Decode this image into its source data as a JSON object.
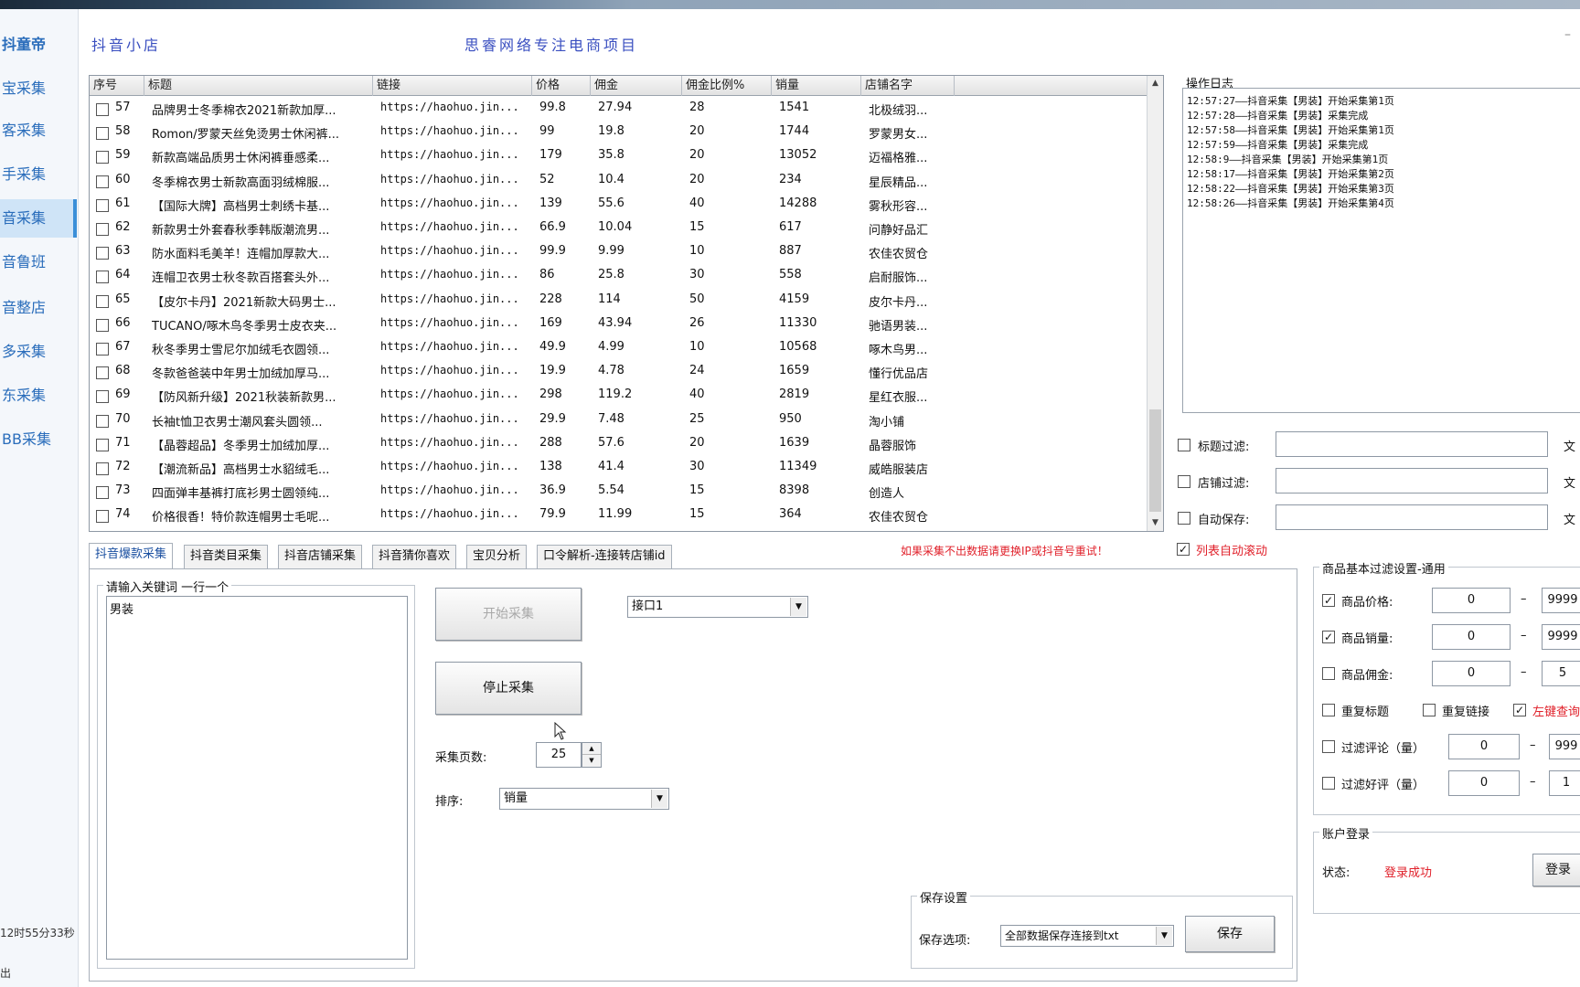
{
  "app": {
    "brand": "抖童帝",
    "shop_name": "抖音小店",
    "slogan": "思睿网络专注电商项目"
  },
  "sidebar": {
    "items": [
      {
        "label": "宝采集"
      },
      {
        "label": "客采集"
      },
      {
        "label": "手采集"
      },
      {
        "label": "音采集"
      },
      {
        "label": "音鲁班"
      },
      {
        "label": "音整店"
      },
      {
        "label": "多采集"
      },
      {
        "label": "东采集"
      },
      {
        "label": "BB采集"
      }
    ],
    "footer_time": "12时55分33秒",
    "footer_exit": "出"
  },
  "grid": {
    "columns": [
      "序号",
      "标题",
      "链接",
      "价格",
      "佣金",
      "佣金比例%",
      "销量",
      "店铺名字"
    ],
    "rows": [
      {
        "id": "57",
        "title": "品牌男士冬季棉衣2021新款加厚...",
        "link": "https://haohuo.jin...",
        "price": "99.8",
        "commission": "27.94",
        "rate": "28",
        "sales": "1541",
        "shop": "北极绒羽..."
      },
      {
        "id": "58",
        "title": "Romon/罗蒙天丝免烫男士休闲裤...",
        "link": "https://haohuo.jin...",
        "price": "99",
        "commission": "19.8",
        "rate": "20",
        "sales": "1744",
        "shop": "罗蒙男女..."
      },
      {
        "id": "59",
        "title": "新款高端品质男士休闲裤垂感柔...",
        "link": "https://haohuo.jin...",
        "price": "179",
        "commission": "35.8",
        "rate": "20",
        "sales": "13052",
        "shop": "迈福格雅..."
      },
      {
        "id": "60",
        "title": "冬季棉衣男士新款高面羽绒棉服...",
        "link": "https://haohuo.jin...",
        "price": "52",
        "commission": "10.4",
        "rate": "20",
        "sales": "234",
        "shop": "星辰精品..."
      },
      {
        "id": "61",
        "title": "【国际大牌】高档男士刺绣卡基...",
        "link": "https://haohuo.jin...",
        "price": "139",
        "commission": "55.6",
        "rate": "40",
        "sales": "14288",
        "shop": "雾秋形容..."
      },
      {
        "id": "62",
        "title": "新款男士外套春秋季韩版潮流男...",
        "link": "https://haohuo.jin...",
        "price": "66.9",
        "commission": "10.04",
        "rate": "15",
        "sales": "617",
        "shop": "问静好品汇"
      },
      {
        "id": "63",
        "title": "防水面料毛美羊！连帽加厚款大...",
        "link": "https://haohuo.jin...",
        "price": "99.9",
        "commission": "9.99",
        "rate": "10",
        "sales": "887",
        "shop": "农佳农贸仓"
      },
      {
        "id": "64",
        "title": "连帽卫衣男士秋冬款百搭套头外...",
        "link": "https://haohuo.jin...",
        "price": "86",
        "commission": "25.8",
        "rate": "30",
        "sales": "558",
        "shop": "启耐服饰..."
      },
      {
        "id": "65",
        "title": "【皮尔卡丹】2021新款大码男士...",
        "link": "https://haohuo.jin...",
        "price": "228",
        "commission": "114",
        "rate": "50",
        "sales": "4159",
        "shop": "皮尔卡丹..."
      },
      {
        "id": "66",
        "title": "TUCANO/啄木鸟冬季男士皮衣夹...",
        "link": "https://haohuo.jin...",
        "price": "169",
        "commission": "43.94",
        "rate": "26",
        "sales": "11330",
        "shop": "驰语男装..."
      },
      {
        "id": "67",
        "title": "秋冬季男士雪尼尔加绒毛衣圆领...",
        "link": "https://haohuo.jin...",
        "price": "49.9",
        "commission": "4.99",
        "rate": "10",
        "sales": "10568",
        "shop": "啄木鸟男..."
      },
      {
        "id": "68",
        "title": "冬款爸爸装中年男士加绒加厚马...",
        "link": "https://haohuo.jin...",
        "price": "19.9",
        "commission": "4.78",
        "rate": "24",
        "sales": "1659",
        "shop": "懂行优品店"
      },
      {
        "id": "69",
        "title": "【防风新升级】2021秋装新款男...",
        "link": "https://haohuo.jin...",
        "price": "298",
        "commission": "119.2",
        "rate": "40",
        "sales": "2819",
        "shop": "星红衣服..."
      },
      {
        "id": "70",
        "title": "长袖t恤卫衣男士潮风套头圆领...",
        "link": "https://haohuo.jin...",
        "price": "29.9",
        "commission": "7.48",
        "rate": "25",
        "sales": "950",
        "shop": "淘小铺"
      },
      {
        "id": "71",
        "title": "【晶蓉超品】冬季男士加绒加厚...",
        "link": "https://haohuo.jin...",
        "price": "288",
        "commission": "57.6",
        "rate": "20",
        "sales": "1639",
        "shop": "晶蓉服饰"
      },
      {
        "id": "72",
        "title": "【潮流新品】高档男士水貂绒毛...",
        "link": "https://haohuo.jin...",
        "price": "138",
        "commission": "41.4",
        "rate": "30",
        "sales": "11349",
        "shop": "威皓服装店"
      },
      {
        "id": "73",
        "title": "四面弹丰基裤打底衫男士圆领纯...",
        "link": "https://haohuo.jin...",
        "price": "36.9",
        "commission": "5.54",
        "rate": "15",
        "sales": "8398",
        "shop": "创造人"
      },
      {
        "id": "74",
        "title": "价格很香！特价款连帽男士毛呢...",
        "link": "https://haohuo.jin...",
        "price": "79.9",
        "commission": "11.99",
        "rate": "15",
        "sales": "364",
        "shop": "农佳农贸仓"
      }
    ]
  },
  "log": {
    "title": "操作日志",
    "lines": [
      "12:57:27——抖音采集【男装】开始采集第1页",
      "12:57:28——抖音采集【男装】采集完成",
      "12:57:58——抖音采集【男装】开始采集第1页",
      "12:57:59——抖音采集【男装】采集完成",
      "12:58:9——抖音采集【男装】开始采集第1页",
      "12:58:17——抖音采集【男装】开始采集第2页",
      "12:58:22——抖音采集【男装】开始采集第3页",
      "12:58:26——抖音采集【男装】开始采集第4页"
    ]
  },
  "filters": {
    "title_filter": "标题过滤:",
    "shop_filter": "店铺过滤:",
    "auto_save": "自动保存:",
    "side_button": "文",
    "auto_scroll": "列表自动滚动",
    "notice": "如果采集不出数据请更换IP或抖音号重试！"
  },
  "tabs": [
    {
      "label": "抖音爆款采集"
    },
    {
      "label": "抖音类目采集"
    },
    {
      "label": "抖音店铺采集"
    },
    {
      "label": "抖音猜你喜欢"
    },
    {
      "label": "宝贝分析"
    },
    {
      "label": "口令解析-连接转店铺id"
    }
  ],
  "collect": {
    "keywords_label": "请输入关键词 一行一个",
    "keywords_value": "男装",
    "start_button": "开始采集",
    "stop_button": "停止采集",
    "interface_value": "接口1",
    "pages_label": "采集页数:",
    "pages_value": "25",
    "sort_label": "排序:",
    "sort_value": "销量"
  },
  "save_settings": {
    "title": "保存设置",
    "option_label": "保存选项:",
    "option_value": "全部数据保存连接到txt",
    "save_button": "保存"
  },
  "basic_filter": {
    "title": "商品基本过滤设置-通用",
    "price_label": "商品价格:",
    "price_min": "0",
    "price_max": "9999",
    "sales_label": "商品销量:",
    "sales_min": "0",
    "sales_max": "9999",
    "commission_label": "商品佣金:",
    "commission_min": "0",
    "commission_max": "5",
    "dup_title": "重复标题",
    "dup_link": "重复链接",
    "left_click": "左键查询",
    "reviews_label": "过滤评论（量）",
    "reviews_min": "0",
    "reviews_max": "999",
    "good_label": "过滤好评（量）",
    "good_min": "0",
    "good_max": "1"
  },
  "account": {
    "title": "账户登录",
    "status_label": "状态:",
    "status_value": "登录成功",
    "login_button": "登录"
  },
  "colors": {
    "accent_blue": "#2a6dbb",
    "header_blue": "#3a4fc0",
    "red": "#e0202a",
    "active_sidebar": "#cfe4f7"
  },
  "icons": [
    "dropdown-arrow-icon",
    "spin-up-icon",
    "spin-down-icon",
    "scroll-up-icon",
    "scroll-down-icon",
    "mouse-cursor-icon"
  ]
}
